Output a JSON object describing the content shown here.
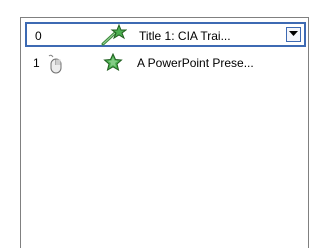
{
  "animation_list": {
    "items": [
      {
        "index": "0",
        "label": "Title 1: CIA Trai...",
        "trigger": "with-previous",
        "effect_icon": "entrance-star-icon",
        "selected": true
      },
      {
        "index": "1",
        "label": "A PowerPoint Prese...",
        "trigger": "on-click",
        "effect_icon": "entrance-star-icon",
        "selected": false
      }
    ]
  },
  "colors": {
    "selection_border": "#3d6ab3",
    "star_green": "#3a8a3a"
  }
}
